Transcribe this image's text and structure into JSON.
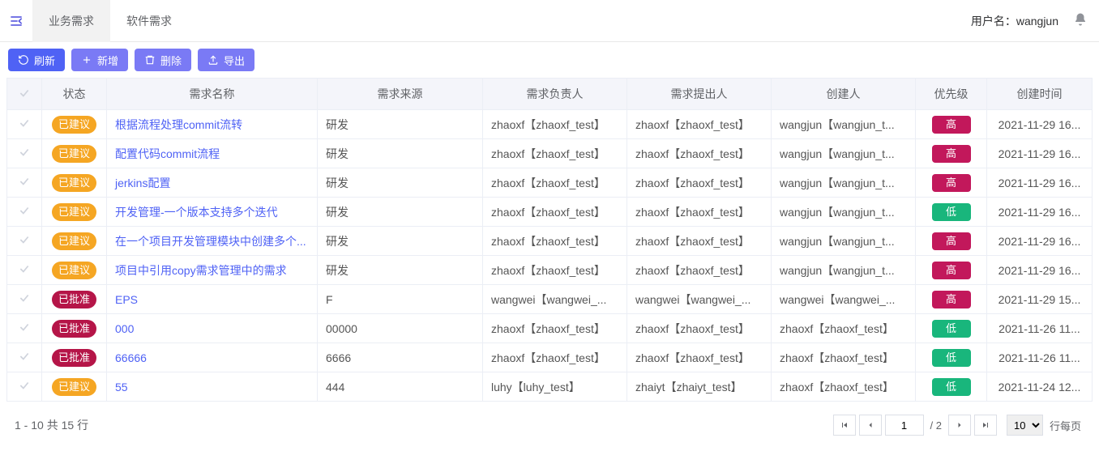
{
  "header": {
    "tabs": [
      "业务需求",
      "软件需求"
    ],
    "active_tab_index": 0,
    "username_label": "用户名：",
    "username": "wangjun"
  },
  "toolbar": {
    "refresh": "刷新",
    "add": "新增",
    "delete": "删除",
    "export": "导出"
  },
  "table": {
    "columns": [
      "",
      "状态",
      "需求名称",
      "需求来源",
      "需求负责人",
      "需求提出人",
      "创建人",
      "优先级",
      "创建时间"
    ],
    "rows": [
      {
        "status": "已建议",
        "status_kind": "suggested",
        "name": "根据流程处理commit流转",
        "source": "研发",
        "owner": "zhaoxf【zhaoxf_test】",
        "proposer": "zhaoxf【zhaoxf_test】",
        "creator": "wangjun【wangjun_t...",
        "priority": "高",
        "priority_kind": "high",
        "created": "2021-11-29 16..."
      },
      {
        "status": "已建议",
        "status_kind": "suggested",
        "name": "配置代码commit流程",
        "source": "研发",
        "owner": "zhaoxf【zhaoxf_test】",
        "proposer": "zhaoxf【zhaoxf_test】",
        "creator": "wangjun【wangjun_t...",
        "priority": "高",
        "priority_kind": "high",
        "created": "2021-11-29 16..."
      },
      {
        "status": "已建议",
        "status_kind": "suggested",
        "name": "jerkins配置",
        "source": "研发",
        "owner": "zhaoxf【zhaoxf_test】",
        "proposer": "zhaoxf【zhaoxf_test】",
        "creator": "wangjun【wangjun_t...",
        "priority": "高",
        "priority_kind": "high",
        "created": "2021-11-29 16..."
      },
      {
        "status": "已建议",
        "status_kind": "suggested",
        "name": "开发管理-一个版本支持多个迭代",
        "source": "研发",
        "owner": "zhaoxf【zhaoxf_test】",
        "proposer": "zhaoxf【zhaoxf_test】",
        "creator": "wangjun【wangjun_t...",
        "priority": "低",
        "priority_kind": "low",
        "created": "2021-11-29 16..."
      },
      {
        "status": "已建议",
        "status_kind": "suggested",
        "name": "在一个项目开发管理模块中创建多个...",
        "source": "研发",
        "owner": "zhaoxf【zhaoxf_test】",
        "proposer": "zhaoxf【zhaoxf_test】",
        "creator": "wangjun【wangjun_t...",
        "priority": "高",
        "priority_kind": "high",
        "created": "2021-11-29 16..."
      },
      {
        "status": "已建议",
        "status_kind": "suggested",
        "name": "项目中引用copy需求管理中的需求",
        "source": "研发",
        "owner": "zhaoxf【zhaoxf_test】",
        "proposer": "zhaoxf【zhaoxf_test】",
        "creator": "wangjun【wangjun_t...",
        "priority": "高",
        "priority_kind": "high",
        "created": "2021-11-29 16..."
      },
      {
        "status": "已批准",
        "status_kind": "approved",
        "name": "EPS",
        "source": "F",
        "owner": "wangwei【wangwei_...",
        "proposer": "wangwei【wangwei_...",
        "creator": "wangwei【wangwei_...",
        "priority": "高",
        "priority_kind": "high",
        "created": "2021-11-29 15..."
      },
      {
        "status": "已批准",
        "status_kind": "approved",
        "name": "000",
        "source": "00000",
        "owner": "zhaoxf【zhaoxf_test】",
        "proposer": "zhaoxf【zhaoxf_test】",
        "creator": "zhaoxf【zhaoxf_test】",
        "priority": "低",
        "priority_kind": "low",
        "created": "2021-11-26 11..."
      },
      {
        "status": "已批准",
        "status_kind": "approved",
        "name": "66666",
        "source": "6666",
        "owner": "zhaoxf【zhaoxf_test】",
        "proposer": "zhaoxf【zhaoxf_test】",
        "creator": "zhaoxf【zhaoxf_test】",
        "priority": "低",
        "priority_kind": "low",
        "created": "2021-11-26 11..."
      },
      {
        "status": "已建议",
        "status_kind": "suggested",
        "name": "55",
        "source": "444",
        "owner": "luhy【luhy_test】",
        "proposer": "zhaiyt【zhaiyt_test】",
        "creator": "zhaoxf【zhaoxf_test】",
        "priority": "低",
        "priority_kind": "low",
        "created": "2021-11-24 12..."
      }
    ]
  },
  "pager": {
    "summary_prefix": "1",
    "summary_sep": " - ",
    "summary_end": "10",
    "summary_total_label": " 共 ",
    "summary_total": "15",
    "summary_total_suffix": " 行",
    "current_page": "1",
    "total_pages_label": "/ 2",
    "page_size": "10",
    "rows_per_page_label": "行每页"
  }
}
